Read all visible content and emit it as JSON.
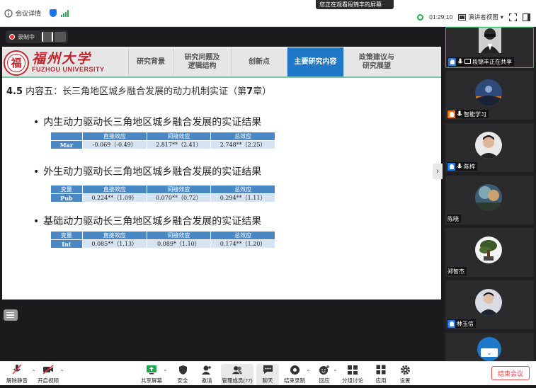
{
  "topbar": {
    "meeting_info": "会议详情",
    "viewing_banner": "您正在观看段锦丰的屏幕",
    "timer": "01:29:10",
    "view_mode": "演讲者视图"
  },
  "recording": {
    "label": "录制中"
  },
  "slide": {
    "logo_cn": "福州大学",
    "logo_en": "FUZHOU UNIVERSITY",
    "logo_seal": "福",
    "nav": [
      {
        "label": "研究背景"
      },
      {
        "label": "研究问题及\n逻辑结构"
      },
      {
        "label": "创新点"
      },
      {
        "label": "主要研究内容"
      },
      {
        "label": "政策建议与\n研究展望"
      }
    ],
    "title_prefix": "4.5",
    "title_text": " 内容五：长三角地区城乡融合发展的动力机制实证（第",
    "title_num": "7",
    "title_suffix": "章）",
    "bullet": "•",
    "sections": [
      {
        "heading": "内生动力驱动长三角地区城乡融合发展的实证结果",
        "headers": [
          "",
          "直接效应",
          "间接效应",
          "总效应"
        ],
        "row": [
          "Mar",
          "-0.069（-0.49）",
          "2.817**（2.41）",
          "2.748**（2.25）"
        ]
      },
      {
        "heading": "外生动力驱动长三角地区城乡融合发展的实证结果",
        "headers": [
          "变量",
          "直接效应",
          "间接效应",
          "总效应"
        ],
        "row": [
          "Pub",
          "0.224**（1.09）",
          "0.070**（0.72）",
          "0.294**（1.11）"
        ]
      },
      {
        "heading": "基础动力驱动长三角地区城乡融合发展的实证结果",
        "headers": [
          "变量",
          "直接效应",
          "间接效应",
          "总效应"
        ],
        "row": [
          "Int",
          "0.085**（1.13）",
          "0.089*（1.10）",
          "0.174**（1.20）"
        ]
      }
    ]
  },
  "participants": [
    {
      "name": "段锦丰正在共享",
      "role": "host",
      "sharing": true
    },
    {
      "name": "智能学习",
      "role": "ai"
    },
    {
      "name": "陈梓",
      "role": "host"
    },
    {
      "name": "陈晓"
    },
    {
      "name": "郑智杰"
    },
    {
      "name": "林玉信"
    }
  ],
  "toolbar": {
    "unmute": "解除静音",
    "video": "开启视频",
    "share": "共享屏幕",
    "security": "安全",
    "invite": "邀请",
    "members": "管理成员(77)",
    "chat": "聊天",
    "end_record": "结束录制",
    "reactions": "回应",
    "breakout": "分组讨论",
    "apps": "应用",
    "settings": "设置",
    "end_meeting": "结束会议"
  }
}
